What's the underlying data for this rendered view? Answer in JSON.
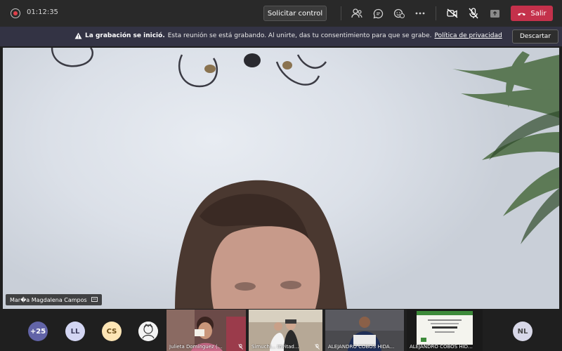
{
  "topbar": {
    "timer": "01:12:35",
    "request_control_label": "Solicitar control",
    "leave_label": "Salir"
  },
  "banner": {
    "title": "La grabación se inició.",
    "message": "Esta reunión se está grabando. Al unirte, das tu consentimiento para que se grabe.",
    "privacy_link": "Política de privacidad",
    "dismiss_label": "Descartar"
  },
  "stage": {
    "speaker_name": "Mar�a Magdalena Campos"
  },
  "participants": {
    "overflow_count": "+25",
    "avatars": [
      {
        "initials": "LL"
      },
      {
        "initials": "CS"
      },
      {
        "initials": "NL"
      }
    ],
    "tiles": [
      {
        "name": "Julieta Domínguez (..."
      },
      {
        "name": "Simuchi... Invitad..."
      },
      {
        "name": "ALEJANDRO COBOS HIDA..."
      },
      {
        "name": "ALEJANDRO COBOS HIDA..."
      }
    ]
  },
  "colors": {
    "leave": "#c4314b",
    "banner": "#333344",
    "avatar_overflow": "#6264a7",
    "avatar_ll": "#d3d6f3",
    "avatar_cs": "#fde5b5",
    "avatar_nl": "#d8d8e8"
  }
}
